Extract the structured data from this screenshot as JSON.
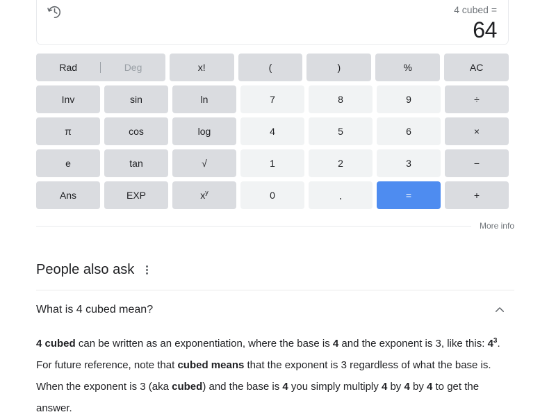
{
  "calculator": {
    "history_icon": "history-icon",
    "expression": "4 cubed =",
    "result": "64",
    "keypad": {
      "rows": [
        {
          "keys": [
            {
              "type": "toggle",
              "name": "rad-deg-toggle",
              "active_label": "Rad",
              "inactive_label": "Deg"
            },
            {
              "type": "func",
              "name": "factorial",
              "label": "x!"
            },
            {
              "type": "func",
              "name": "open-paren",
              "label": "("
            },
            {
              "type": "func",
              "name": "close-paren",
              "label": ")"
            },
            {
              "type": "func",
              "name": "percent",
              "label": "%"
            },
            {
              "type": "func",
              "name": "all-clear",
              "label": "AC"
            }
          ]
        },
        {
          "keys": [
            {
              "type": "func",
              "name": "inverse",
              "label": "Inv"
            },
            {
              "type": "func",
              "name": "sine",
              "label": "sin"
            },
            {
              "type": "func",
              "name": "natural-log",
              "label": "ln"
            },
            {
              "type": "num",
              "name": "digit-7",
              "label": "7"
            },
            {
              "type": "num",
              "name": "digit-8",
              "label": "8"
            },
            {
              "type": "num",
              "name": "digit-9",
              "label": "9"
            },
            {
              "type": "func",
              "name": "divide",
              "label": "÷"
            }
          ]
        },
        {
          "keys": [
            {
              "type": "func",
              "name": "pi",
              "label": "π"
            },
            {
              "type": "func",
              "name": "cosine",
              "label": "cos"
            },
            {
              "type": "func",
              "name": "log",
              "label": "log"
            },
            {
              "type": "num",
              "name": "digit-4",
              "label": "4"
            },
            {
              "type": "num",
              "name": "digit-5",
              "label": "5"
            },
            {
              "type": "num",
              "name": "digit-6",
              "label": "6"
            },
            {
              "type": "func",
              "name": "multiply",
              "label": "×"
            }
          ]
        },
        {
          "keys": [
            {
              "type": "func",
              "name": "eulers-number",
              "label": "e"
            },
            {
              "type": "func",
              "name": "tangent",
              "label": "tan"
            },
            {
              "type": "func",
              "name": "square-root",
              "label": "√"
            },
            {
              "type": "num",
              "name": "digit-1",
              "label": "1"
            },
            {
              "type": "num",
              "name": "digit-2",
              "label": "2"
            },
            {
              "type": "num",
              "name": "digit-3",
              "label": "3"
            },
            {
              "type": "func",
              "name": "minus",
              "label": "−"
            }
          ]
        },
        {
          "keys": [
            {
              "type": "func",
              "name": "answer",
              "label": "Ans"
            },
            {
              "type": "func",
              "name": "exponent",
              "label": "EXP"
            },
            {
              "type": "power",
              "name": "power",
              "base": "x",
              "exponent": "y"
            },
            {
              "type": "num",
              "name": "digit-0",
              "label": "0"
            },
            {
              "type": "num",
              "name": "decimal-point",
              "label": "."
            },
            {
              "type": "equals",
              "name": "equals",
              "label": "="
            },
            {
              "type": "func",
              "name": "plus",
              "label": "+"
            }
          ]
        }
      ]
    }
  },
  "more_info": {
    "label": "More info"
  },
  "people_also_ask": {
    "title": "People also ask",
    "menu_icon": "overflow-menu-icon",
    "items": [
      {
        "question": "What is 4 cubed mean?",
        "expanded": true,
        "chevron_icon": "chevron-up-icon",
        "answer_parts": [
          {
            "text": "4 cubed",
            "bold": true
          },
          {
            "text": " can be written as an exponentiation, where the base is ",
            "bold": false
          },
          {
            "text": "4",
            "bold": true
          },
          {
            "text": " and the exponent is 3, like this: ",
            "bold": false
          },
          {
            "text": "4",
            "bold": true,
            "sup": "3"
          },
          {
            "text": ". For future reference, note that ",
            "bold": false
          },
          {
            "text": "cubed means",
            "bold": true
          },
          {
            "text": " that the exponent is 3 regardless of what the base is. When the exponent is 3 (aka ",
            "bold": false
          },
          {
            "text": "cubed",
            "bold": true
          },
          {
            "text": ") and the base is ",
            "bold": false
          },
          {
            "text": "4",
            "bold": true
          },
          {
            "text": " you simply multiply ",
            "bold": false
          },
          {
            "text": "4",
            "bold": true
          },
          {
            "text": " by ",
            "bold": false
          },
          {
            "text": "4",
            "bold": true
          },
          {
            "text": " by ",
            "bold": false
          },
          {
            "text": "4",
            "bold": true
          },
          {
            "text": " to get the answer.",
            "bold": false
          }
        ]
      }
    ]
  },
  "colors": {
    "function_key": "#dadce0",
    "number_key": "#f1f3f4",
    "equals_key": "#4e8cf0",
    "text_primary": "#202124",
    "text_secondary": "#70757a",
    "divider": "#ebebeb"
  }
}
